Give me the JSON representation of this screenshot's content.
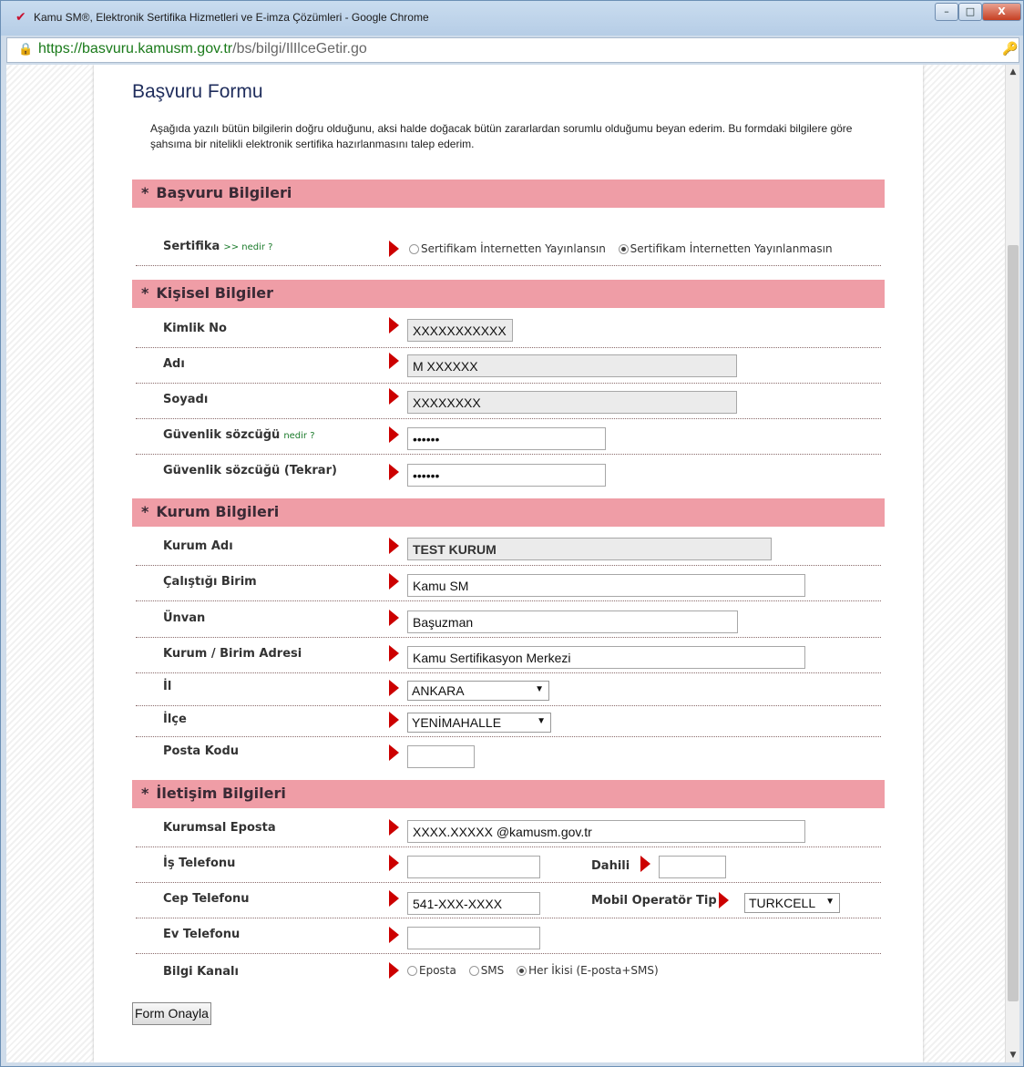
{
  "window": {
    "title": "Kamu SM®, Elektronik Sertifika Hizmetleri ve E-imza Çözümleri - Google Chrome",
    "min": "–",
    "max": "□",
    "close": "X"
  },
  "address": {
    "host": "https://basvuru.kamusm.gov.tr",
    "path": "/bs/bilgi/IlIlceGetir.go"
  },
  "form": {
    "title": "Başvuru Formu",
    "intro": "Aşağıda yazılı bütün bilgilerin doğru olduğunu, aksi halde doğacak bütün zararlardan sorumlu olduğumu beyan ederim. Bu formdaki bilgilere göre şahsıma bir nitelikli elektronik sertifika hazırlanmasını talep ederim.",
    "sections": {
      "basvuru": "Başvuru Bilgileri",
      "kisisel": "Kişisel Bilgiler",
      "kurum": "Kurum Bilgileri",
      "iletisim": "İletişim Bilgileri"
    },
    "asterisk": "*",
    "nedir": ">> nedir ?",
    "nedir2": "nedir ?",
    "sertifika": {
      "label": "Sertifika",
      "opt1": "Sertifikam İnternetten Yayınlansın",
      "opt2": "Sertifikam İnternetten Yayınlanmasın",
      "selected": "opt2"
    },
    "kimlik": {
      "label": "Kimlik No",
      "value": "XXXXXXXXXXX"
    },
    "adi": {
      "label": "Adı",
      "value": "M XXXXXX"
    },
    "soyadi": {
      "label": "Soyadı",
      "value": "XXXXXXXX"
    },
    "guvenlik": {
      "label": "Güvenlik sözcüğü",
      "value": "••••••"
    },
    "guvenlik2": {
      "label": "Güvenlik sözcüğü (Tekrar)",
      "value": "••••••"
    },
    "kurum_adi": {
      "label": "Kurum Adı",
      "value": "TEST KURUM"
    },
    "birim": {
      "label": "Çalıştığı Birim",
      "value": "Kamu SM"
    },
    "unvan": {
      "label": "Ünvan",
      "value": "Başuzman"
    },
    "adres": {
      "label": "Kurum / Birim Adresi",
      "value": "Kamu Sertifikasyon Merkezi"
    },
    "il": {
      "label": "İl",
      "value": "ANKARA"
    },
    "ilce": {
      "label": "İlçe",
      "value": "YENİMAHALLE"
    },
    "posta": {
      "label": "Posta Kodu",
      "value": ""
    },
    "eposta": {
      "label": "Kurumsal Eposta",
      "value": "XXXX.XXXXX @kamusm.gov.tr"
    },
    "is_tel": {
      "label": "İş Telefonu",
      "value": "",
      "dahili_label": "Dahili",
      "dahili_value": ""
    },
    "cep": {
      "label": "Cep Telefonu",
      "value": "541-XXX-XXXX",
      "operator_label": "Mobil Operatör Tip",
      "operator_value": "TURKCELL"
    },
    "ev_tel": {
      "label": "Ev Telefonu",
      "value": ""
    },
    "kanal": {
      "label": "Bilgi Kanalı",
      "opt1": "Eposta",
      "opt2": "SMS",
      "opt3": "Her İkisi (E-posta+SMS)",
      "selected": "opt3"
    },
    "submit": "Form Onayla"
  },
  "colors": {
    "section_bg": "#ef9da6",
    "arrow": "#cc0000",
    "title": "#1f2d5c"
  },
  "icons": {
    "favicon": "kamusm-check-icon",
    "lock": "lock-icon",
    "key": "key-icon"
  }
}
